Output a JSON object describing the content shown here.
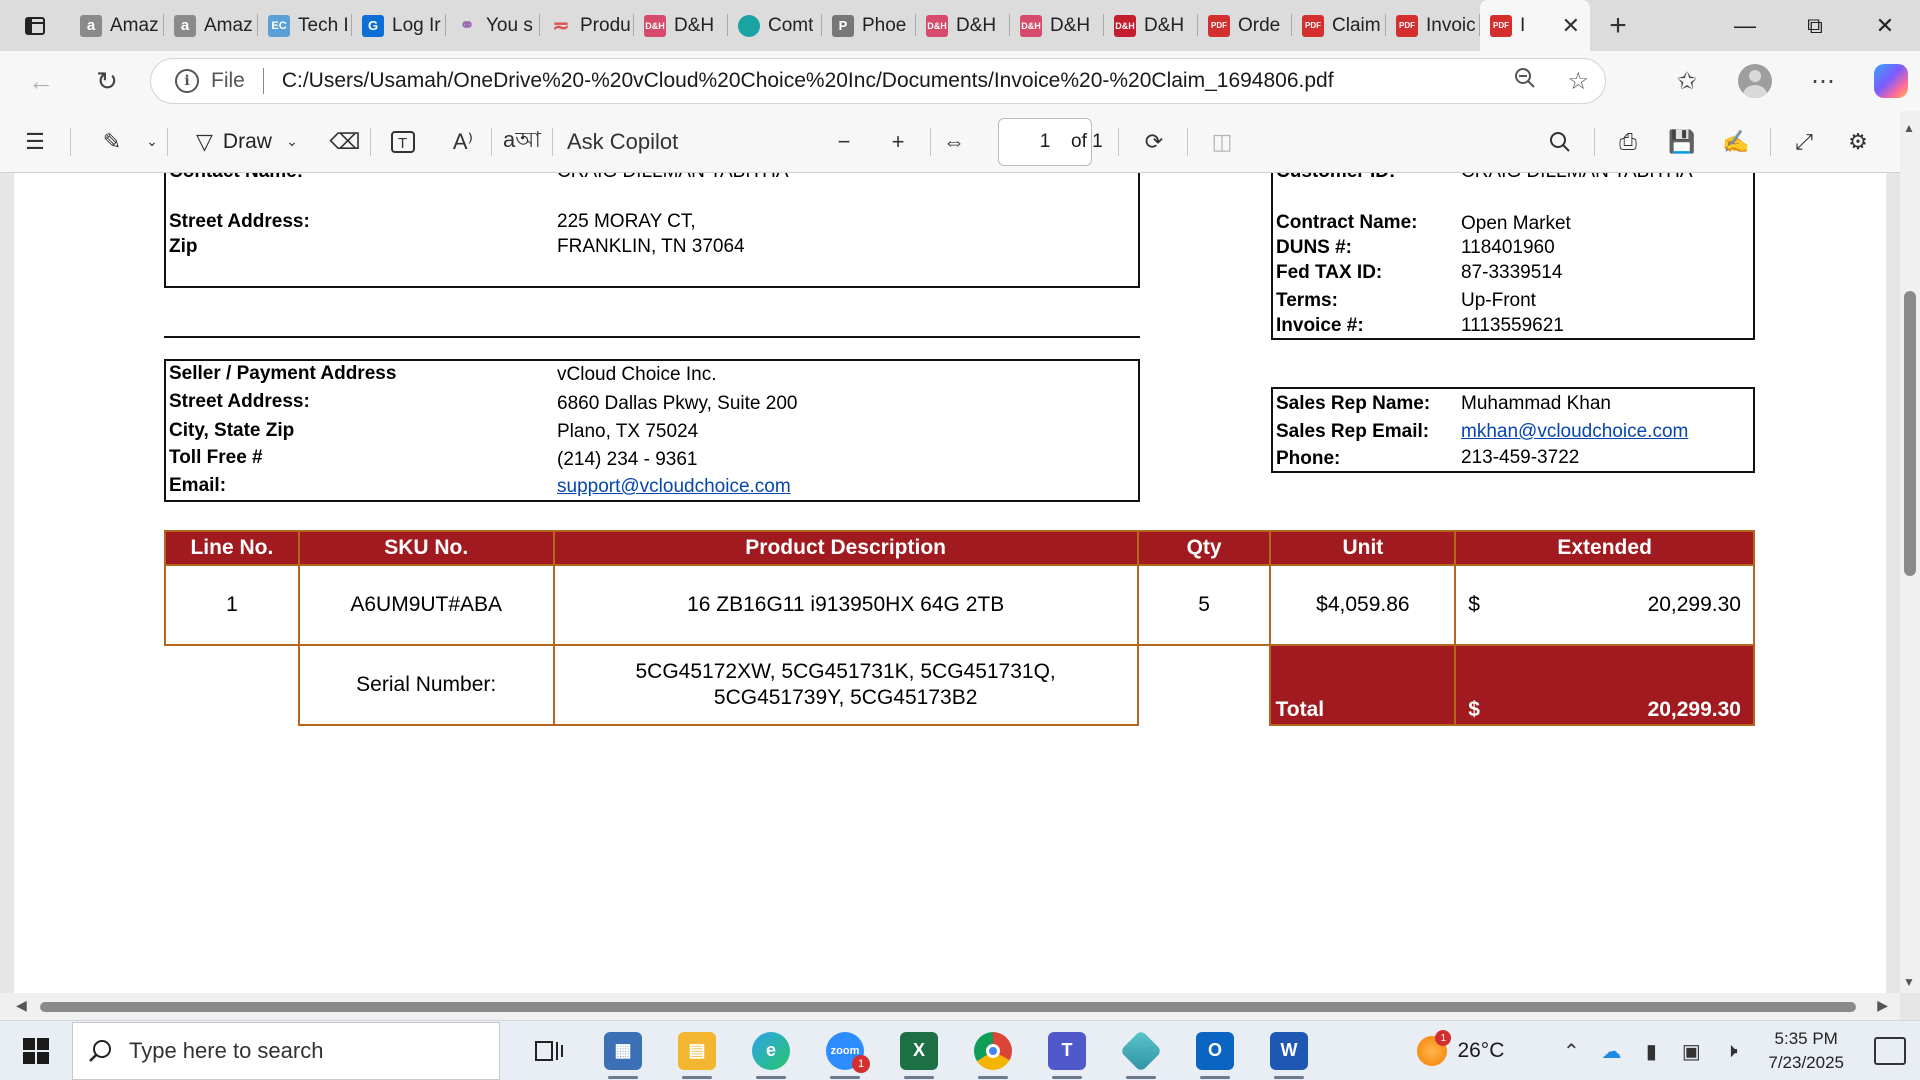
{
  "browser": {
    "tabs": [
      {
        "label": "Amaz",
        "icon": "amazon-icon"
      },
      {
        "label": "Amaz",
        "icon": "amazon-icon"
      },
      {
        "label": "Tech I",
        "icon": "techdata-icon"
      },
      {
        "label": "Log Ir",
        "icon": "login-icon"
      },
      {
        "label": "You s",
        "icon": "users-icon"
      },
      {
        "label": "Produ",
        "icon": "product-icon"
      },
      {
        "label": "D&H",
        "icon": "dh-icon"
      },
      {
        "label": "Comt",
        "icon": "comt-icon"
      },
      {
        "label": "Phoe",
        "icon": "phoenix-icon"
      },
      {
        "label": "D&H",
        "icon": "dh-icon"
      },
      {
        "label": "D&H",
        "icon": "dh-icon"
      },
      {
        "label": "D&H",
        "icon": "dh-icon"
      },
      {
        "label": "Orde",
        "icon": "pdf-icon"
      },
      {
        "label": "Claim",
        "icon": "pdf-icon"
      },
      {
        "label": "Invoic",
        "icon": "pdf-icon"
      }
    ],
    "active_tab": {
      "label": "I",
      "icon": "pdf-icon"
    },
    "address": {
      "scheme_label": "File",
      "url": "C:/Users/Usamah/OneDrive%20-%20vCloud%20Choice%20Inc/Documents/Invoice%20-%20Claim_1694806.pdf"
    }
  },
  "pdf_toolbar": {
    "draw_label": "Draw",
    "ask_copilot_label": "Ask Copilot",
    "page_number": "1",
    "page_total": "of 1"
  },
  "invoice": {
    "buyer": {
      "contact_label": "Contact Name:",
      "contact_value": "CRAIG DILLMAN TABITHA",
      "street_label": "Street Address:",
      "street_value": "225 MORAY CT,",
      "zip_label": "Zip",
      "zip_value": "FRANKLIN, TN 37064"
    },
    "account": {
      "customer_id_label": "Customer ID:",
      "customer_id_value": "CRAIG DILLMAN TABITHA",
      "contract_label": "Contract Name:",
      "contract_value": "Open Market",
      "duns_label": "DUNS #:",
      "duns_value": "118401960",
      "fedtax_label": "Fed TAX ID:",
      "fedtax_value": "87-3339514",
      "terms_label": "Terms:",
      "terms_value": "Up-Front",
      "invoice_label": "Invoice #:",
      "invoice_value": "1113559621"
    },
    "seller": {
      "seller_label": "Seller / Payment Address",
      "seller_value": "vCloud Choice Inc.",
      "street_label": "Street Address:",
      "street_value": "6860 Dallas Pkwy, Suite 200",
      "city_label": "City, State Zip",
      "city_value": "Plano, TX 75024",
      "tollfree_label": "Toll Free #",
      "tollfree_value": "(214) 234 - 9361",
      "email_label": "Email:",
      "email_value": "support@vcloudchoice.com"
    },
    "sales_rep": {
      "name_label": "Sales Rep Name:",
      "name_value": "Muhammad Khan",
      "email_label": "Sales Rep Email:",
      "email_value": "mkhan@vcloudchoice.com",
      "phone_label": "Phone:",
      "phone_value": "213-459-3722"
    },
    "table": {
      "headers": [
        "Line No.",
        "SKU No.",
        "Product Description",
        "Qty",
        "Unit",
        "Extended"
      ],
      "rows": [
        {
          "line": "1",
          "sku": "A6UM9UT#ABA",
          "description": "16 ZB16G11 i913950HX 64G 2TB",
          "qty": "5",
          "unit": "$4,059.86",
          "ext_symbol": "$",
          "ext_value": "20,299.30"
        }
      ],
      "serial_label": "Serial Number:",
      "serial_line1": "5CG45172XW, 5CG451731K, 5CG451731Q,",
      "serial_line2": "5CG451739Y, 5CG45173B2",
      "total_label": "Total",
      "total_symbol": "$",
      "total_value": "20,299.30"
    }
  },
  "taskbar": {
    "search_placeholder": "Type here to search",
    "zoom_badge": "1",
    "weather_badge": "1",
    "temperature": "26°C",
    "time": "5:35 PM",
    "date": "7/23/2025"
  },
  "colors": {
    "table_header": "#a11a1f",
    "table_border": "#b5651d",
    "link": "#0645ad"
  }
}
